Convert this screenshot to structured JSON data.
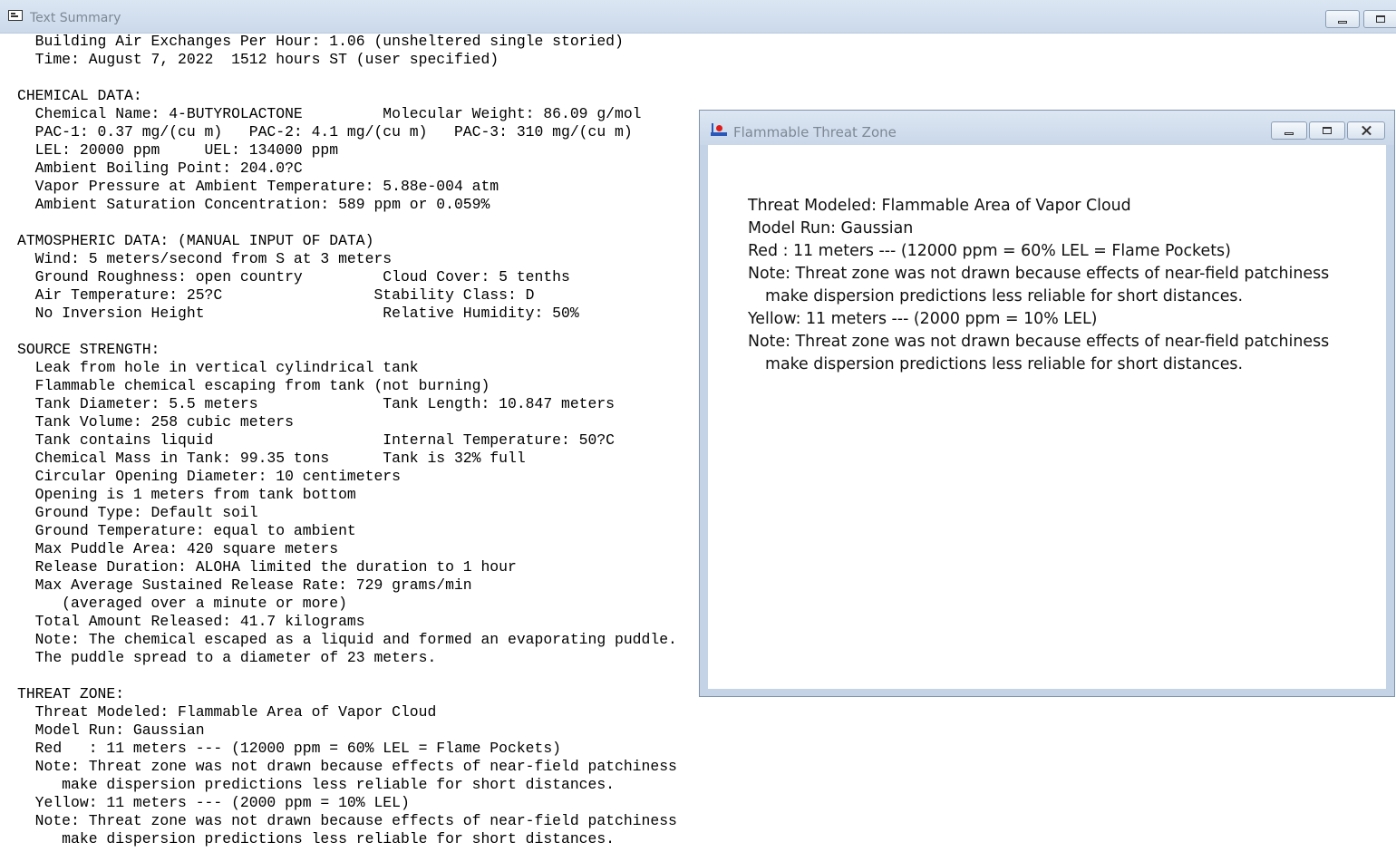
{
  "main_window": {
    "title": "Text Summary",
    "summary_lines": [
      "  Building Air Exchanges Per Hour: 1.06 (unsheltered single storied)",
      "  Time: August 7, 2022  1512 hours ST (user specified)",
      "",
      "CHEMICAL DATA:",
      "  Chemical Name: 4-BUTYROLACTONE         Molecular Weight: 86.09 g/mol",
      "  PAC-1: 0.37 mg/(cu m)   PAC-2: 4.1 mg/(cu m)   PAC-3: 310 mg/(cu m)",
      "  LEL: 20000 ppm     UEL: 134000 ppm",
      "  Ambient Boiling Point: 204.0?C",
      "  Vapor Pressure at Ambient Temperature: 5.88e-004 atm",
      "  Ambient Saturation Concentration: 589 ppm or 0.059%",
      "",
      "ATMOSPHERIC DATA: (MANUAL INPUT OF DATA)",
      "  Wind: 5 meters/second from S at 3 meters",
      "  Ground Roughness: open country         Cloud Cover: 5 tenths",
      "  Air Temperature: 25?C                 Stability Class: D",
      "  No Inversion Height                    Relative Humidity: 50%",
      "",
      "SOURCE STRENGTH:",
      "  Leak from hole in vertical cylindrical tank",
      "  Flammable chemical escaping from tank (not burning)",
      "  Tank Diameter: 5.5 meters              Tank Length: 10.847 meters",
      "  Tank Volume: 258 cubic meters",
      "  Tank contains liquid                   Internal Temperature: 50?C",
      "  Chemical Mass in Tank: 99.35 tons      Tank is 32% full",
      "  Circular Opening Diameter: 10 centimeters",
      "  Opening is 1 meters from tank bottom",
      "  Ground Type: Default soil",
      "  Ground Temperature: equal to ambient",
      "  Max Puddle Area: 420 square meters",
      "  Release Duration: ALOHA limited the duration to 1 hour",
      "  Max Average Sustained Release Rate: 729 grams/min",
      "     (averaged over a minute or more)",
      "  Total Amount Released: 41.7 kilograms",
      "  Note: The chemical escaped as a liquid and formed an evaporating puddle.",
      "  The puddle spread to a diameter of 23 meters.",
      "",
      "THREAT ZONE:",
      "  Threat Modeled: Flammable Area of Vapor Cloud",
      "  Model Run: Gaussian",
      "  Red   : 11 meters --- (12000 ppm = 60% LEL = Flame Pockets)",
      "  Note: Threat zone was not drawn because effects of near-field patchiness",
      "     make dispersion predictions less reliable for short distances.",
      "  Yellow: 11 meters --- (2000 ppm = 10% LEL)",
      "  Note: Threat zone was not drawn because effects of near-field patchiness",
      "     make dispersion predictions less reliable for short distances."
    ]
  },
  "threat_window": {
    "title": "Flammable Threat Zone",
    "lines": [
      {
        "text": "Threat Modeled: Flammable Area of Vapor Cloud",
        "indent": false
      },
      {
        "text": "Model Run: Gaussian",
        "indent": false
      },
      {
        "text": "Red   : 11 meters --- (12000 ppm = 60% LEL = Flame Pockets)",
        "indent": false
      },
      {
        "text": "Note: Threat zone was not drawn because effects of near-field patchiness",
        "indent": false
      },
      {
        "text": "make dispersion predictions less reliable for short distances.",
        "indent": true
      },
      {
        "text": "Yellow: 11 meters --- (2000 ppm = 10% LEL)",
        "indent": false
      },
      {
        "text": "Note: Threat zone was not drawn because effects of near-field patchiness",
        "indent": false
      },
      {
        "text": "make dispersion predictions less reliable for short distances.",
        "indent": true
      }
    ]
  },
  "icons": {
    "main_window_icon": "text-document-icon",
    "threat_window_icon": "flame-threat-icon",
    "minimize": "minimize-icon",
    "maximize": "maximize-icon",
    "close": "close-icon"
  }
}
